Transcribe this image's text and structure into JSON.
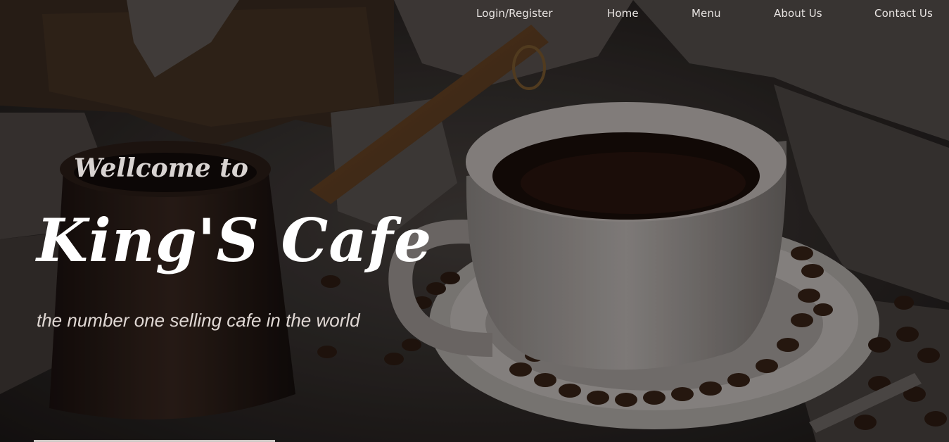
{
  "nav": {
    "items": [
      {
        "label": "Login/Register"
      },
      {
        "label": "Home"
      },
      {
        "label": "Menu"
      },
      {
        "label": "About Us"
      },
      {
        "label": "Contact Us"
      }
    ]
  },
  "hero": {
    "welcome": "Wellcome to",
    "title": "King'S Cafe",
    "tagline": "the number one selling cafe in the world"
  }
}
